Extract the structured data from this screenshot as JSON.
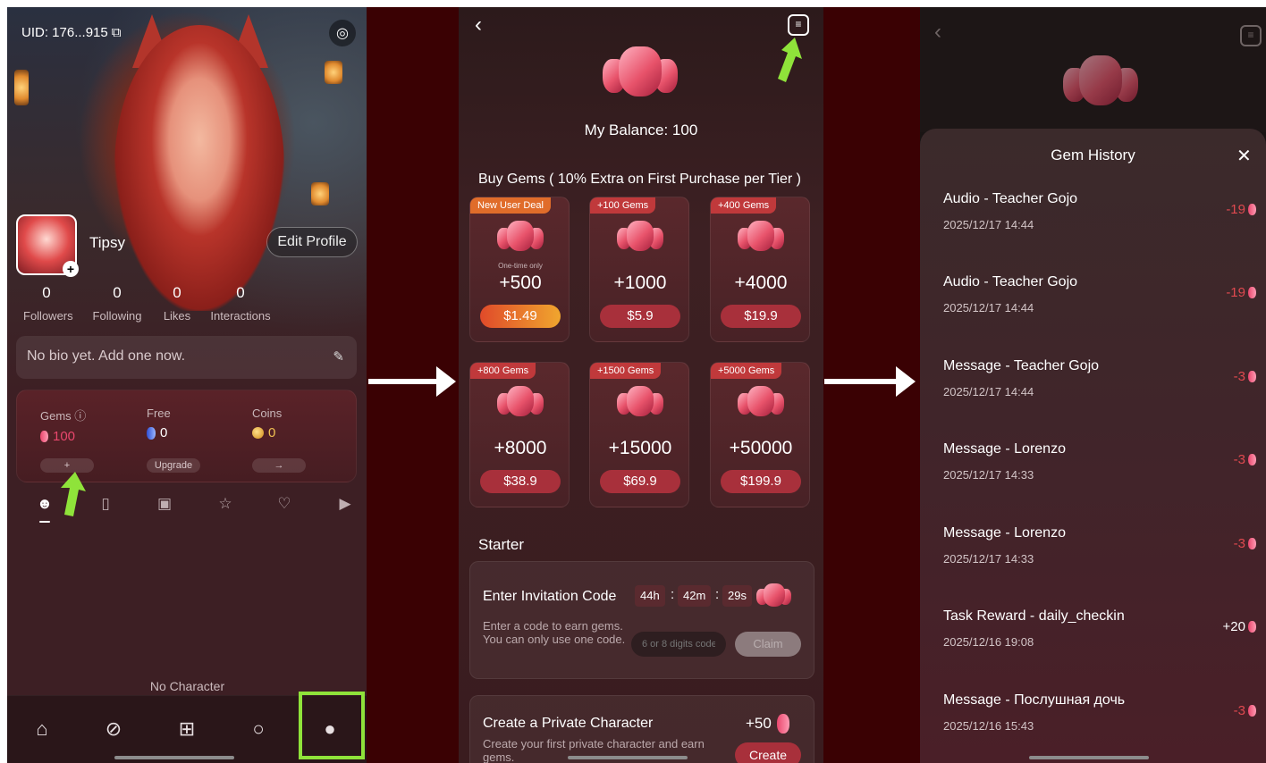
{
  "profile": {
    "uid": "UID: 176...915",
    "copy_icon": "copy-icon",
    "username": "Tipsy",
    "edit_label": "Edit Profile",
    "stats": [
      {
        "num": "0",
        "label": "Followers"
      },
      {
        "num": "0",
        "label": "Following"
      },
      {
        "num": "0",
        "label": "Likes"
      },
      {
        "num": "0",
        "label": "Interactions"
      }
    ],
    "bio_placeholder": "No bio yet. Add one now.",
    "wallet": {
      "gems_label": "Gems",
      "gems_value": "100",
      "gems_button": "+",
      "free_label": "Free",
      "free_value": "0",
      "free_button": "Upgrade",
      "coins_label": "Coins",
      "coins_value": "0",
      "coins_button": "→"
    },
    "empty_text": "No Character"
  },
  "store": {
    "balance": "My Balance: 100",
    "buy_title": "Buy Gems ( 10% Extra on First Purchase per Tier )",
    "packs": [
      {
        "badge": "New User Deal",
        "note": "One-time only",
        "amount": "+500",
        "price": "$1.49"
      },
      {
        "badge": "+100 Gems",
        "note": "",
        "amount": "+1000",
        "price": "$5.9"
      },
      {
        "badge": "+400 Gems",
        "note": "",
        "amount": "+4000",
        "price": "$19.9"
      },
      {
        "badge": "+800 Gems",
        "note": "",
        "amount": "+8000",
        "price": "$38.9"
      },
      {
        "badge": "+1500 Gems",
        "note": "",
        "amount": "+15000",
        "price": "$69.9"
      },
      {
        "badge": "+5000 Gems",
        "note": "",
        "amount": "+50000",
        "price": "$199.9"
      }
    ],
    "starter_title": "Starter",
    "invite": {
      "title": "Enter Invitation Code",
      "h": "44h",
      "m": "42m",
      "s": "29s",
      "desc": "Enter a code to earn gems. You can only use one code.",
      "placeholder": "6 or 8 digits code",
      "claim": "Claim"
    },
    "private": {
      "title": "Create a Private Character",
      "amount": "+50",
      "desc": "Create your first private character and earn gems.",
      "button": "Create"
    }
  },
  "history": {
    "title": "Gem History",
    "items": [
      {
        "title": "Audio - Teacher Gojo",
        "time": "2025/12/17 14:44",
        "amount": "-19"
      },
      {
        "title": "Audio - Teacher Gojo",
        "time": "2025/12/17 14:44",
        "amount": "-19"
      },
      {
        "title": "Message - Teacher Gojo",
        "time": "2025/12/17 14:44",
        "amount": "-3"
      },
      {
        "title": "Message - Lorenzo",
        "time": "2025/12/17 14:33",
        "amount": "-3"
      },
      {
        "title": "Message - Lorenzo",
        "time": "2025/12/17 14:33",
        "amount": "-3"
      },
      {
        "title": "Task Reward - daily_checkin",
        "time": "2025/12/16 19:08",
        "amount": "+20"
      },
      {
        "title": "Message - Послушная дочь",
        "time": "2025/12/16 15:43",
        "amount": "-3"
      }
    ]
  },
  "colors": {
    "highlight": "#8fe33a",
    "accent": "#a8303b",
    "negative": "#e0494f"
  }
}
